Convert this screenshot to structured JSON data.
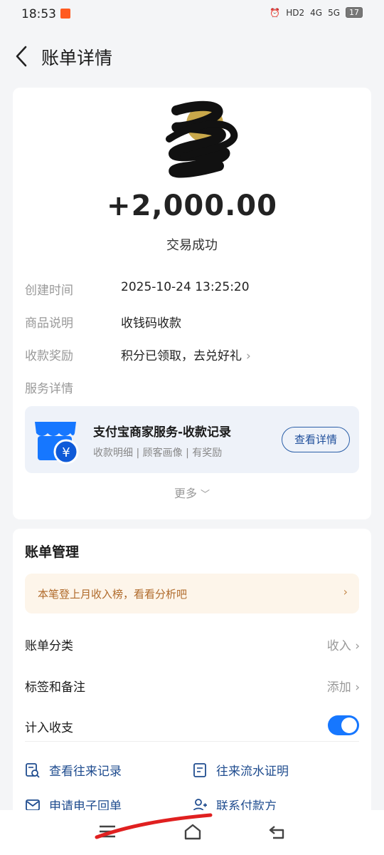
{
  "status_bar": {
    "time": "18:53",
    "indicators": [
      "alarm-icon",
      "HD2",
      "4G",
      "5G"
    ],
    "battery": "17"
  },
  "header": {
    "title": "账单详情"
  },
  "transaction": {
    "amount": "+2,000.00",
    "status": "交易成功",
    "details": [
      {
        "label": "创建时间",
        "value": "2025-10-24 13:25:20"
      },
      {
        "label": "商品说明",
        "value": "收钱码收款"
      },
      {
        "label": "收款奖励",
        "value": "积分已领取，去兑好礼"
      },
      {
        "label": "服务详情",
        "value": ""
      }
    ],
    "service": {
      "title": "支付宝商家服务-收款记录",
      "subtitle": "收款明细 | 顾客画像 | 有奖励",
      "button": "查看详情"
    },
    "more": "更多"
  },
  "management": {
    "title": "账单管理",
    "tip": "本笔登上月收入榜，看看分析吧",
    "rows": [
      {
        "label": "账单分类",
        "value": "收入"
      },
      {
        "label": "标签和备注",
        "value": "添加"
      },
      {
        "label": "计入收支",
        "value": ""
      }
    ],
    "toggle_on": true,
    "links": [
      {
        "label": "查看往来记录",
        "icon": "record-search-icon"
      },
      {
        "label": "往来流水证明",
        "icon": "document-icon"
      },
      {
        "label": "申请电子回单",
        "icon": "mail-icon"
      },
      {
        "label": "联系付款方",
        "icon": "contact-person-icon"
      }
    ]
  },
  "colors": {
    "accent": "#1677ff",
    "link": "#1f4c8f",
    "tip_bg": "#fdf5ea",
    "tip_text": "#b06a2a"
  }
}
